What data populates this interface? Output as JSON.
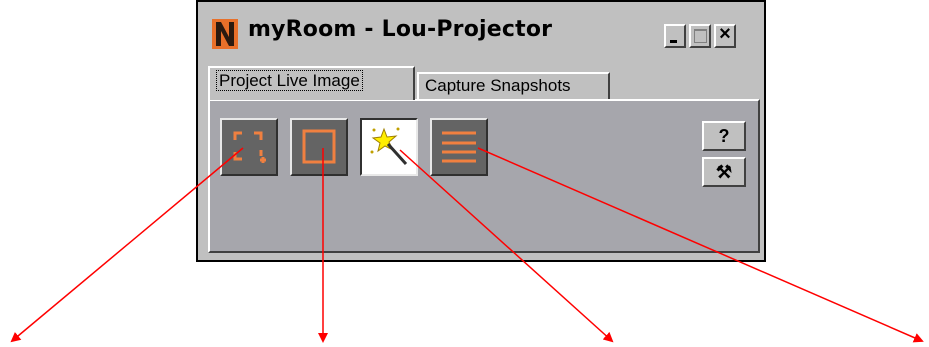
{
  "window": {
    "title": "myRoom - Lou-Projector",
    "controls": {
      "minimize": "_",
      "maximize": "□",
      "close": "×"
    }
  },
  "tabs": [
    {
      "label": "Project Live Image",
      "active": true
    },
    {
      "label": "Capture Snapshots",
      "active": false
    }
  ],
  "toolbar": {
    "tools": [
      {
        "icon": "select-region-icon",
        "selected": false
      },
      {
        "icon": "fullscreen-frame-icon",
        "selected": false
      },
      {
        "icon": "magic-wand-icon",
        "selected": true
      },
      {
        "icon": "lines-menu-icon",
        "selected": false
      }
    ],
    "help_label": "?",
    "settings_label": "⚒"
  },
  "colors": {
    "accent": "#f08040",
    "arrow": "#ff0000",
    "panel": "#a6a6ac"
  }
}
